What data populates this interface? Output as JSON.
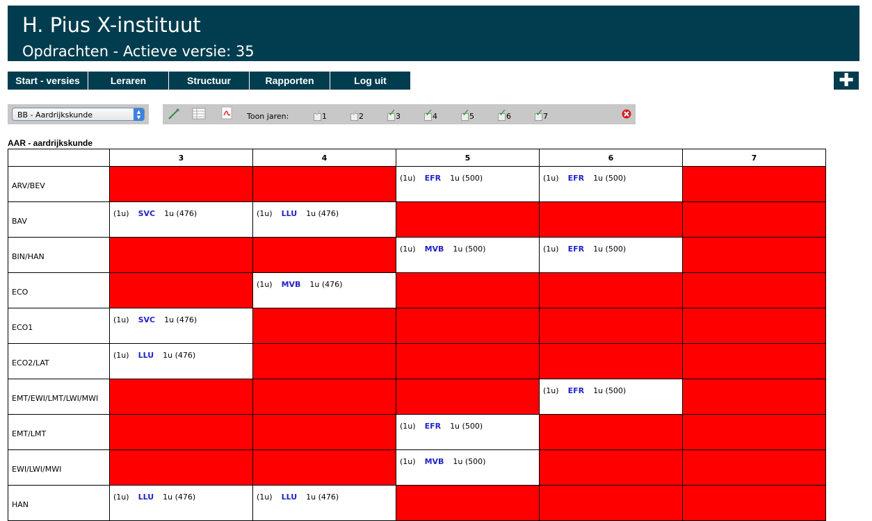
{
  "header": {
    "title": "H. Pius X-instituut",
    "subtitle": "Opdrachten - Actieve versie: 35"
  },
  "nav": [
    "Start - versies",
    "Leraren",
    "Structuur",
    "Rapporten",
    "Log uit"
  ],
  "add_label": "✚",
  "select": {
    "value": "BB - Aardrijkskunde"
  },
  "toolbar": {
    "icons": [
      "pencil-icon",
      "table-icon",
      "pdf-icon"
    ],
    "toon_jaren_label": "Toon jaren:",
    "years": [
      {
        "label": "1",
        "checked": false
      },
      {
        "label": "2",
        "checked": false
      },
      {
        "label": "3",
        "checked": true
      },
      {
        "label": "4",
        "checked": true
      },
      {
        "label": "5",
        "checked": true
      },
      {
        "label": "6",
        "checked": true
      },
      {
        "label": "7",
        "checked": true
      }
    ]
  },
  "section_title": "AAR - aardrijkskunde",
  "columns": [
    "3",
    "4",
    "5",
    "6",
    "7"
  ],
  "rows": [
    {
      "label": "ARV/BEV",
      "cells": [
        null,
        null,
        {
          "hours": "(1u)",
          "code": "EFR",
          "detail": "1u (500)"
        },
        {
          "hours": "(1u)",
          "code": "EFR",
          "detail": "1u (500)"
        },
        null
      ]
    },
    {
      "label": "BAV",
      "cells": [
        {
          "hours": "(1u)",
          "code": "SVC",
          "detail": "1u (476)"
        },
        {
          "hours": "(1u)",
          "code": "LLU",
          "detail": "1u (476)"
        },
        null,
        null,
        null
      ]
    },
    {
      "label": "BIN/HAN",
      "cells": [
        null,
        null,
        {
          "hours": "(1u)",
          "code": "MVB",
          "detail": "1u (500)"
        },
        {
          "hours": "(1u)",
          "code": "EFR",
          "detail": "1u (500)"
        },
        null
      ]
    },
    {
      "label": "ECO",
      "cells": [
        null,
        {
          "hours": "(1u)",
          "code": "MVB",
          "detail": "1u (476)"
        },
        null,
        null,
        null
      ]
    },
    {
      "label": "ECO1",
      "cells": [
        {
          "hours": "(1u)",
          "code": "SVC",
          "detail": "1u (476)"
        },
        null,
        null,
        null,
        null
      ]
    },
    {
      "label": "ECO2/LAT",
      "cells": [
        {
          "hours": "(1u)",
          "code": "LLU",
          "detail": "1u (476)"
        },
        null,
        null,
        null,
        null
      ]
    },
    {
      "label": "EMT/EWI/LMT/LWI/MWI",
      "cells": [
        null,
        null,
        null,
        {
          "hours": "(1u)",
          "code": "EFR",
          "detail": "1u (500)"
        },
        null
      ]
    },
    {
      "label": "EMT/LMT",
      "cells": [
        null,
        null,
        {
          "hours": "(1u)",
          "code": "EFR",
          "detail": "1u (500)"
        },
        null,
        null
      ]
    },
    {
      "label": "EWI/LWI/MWI",
      "cells": [
        null,
        null,
        {
          "hours": "(1u)",
          "code": "MVB",
          "detail": "1u (500)"
        },
        null,
        null
      ]
    },
    {
      "label": "HAN",
      "cells": [
        {
          "hours": "(1u)",
          "code": "LLU",
          "detail": "1u (476)"
        },
        {
          "hours": "(1u)",
          "code": "LLU",
          "detail": "1u (476)"
        },
        null,
        null,
        null
      ]
    }
  ],
  "colors": {
    "header": "#013d4e",
    "unassigned": "#ff0000",
    "code": "#2222c8",
    "toolbar": "#c8c8c8"
  }
}
